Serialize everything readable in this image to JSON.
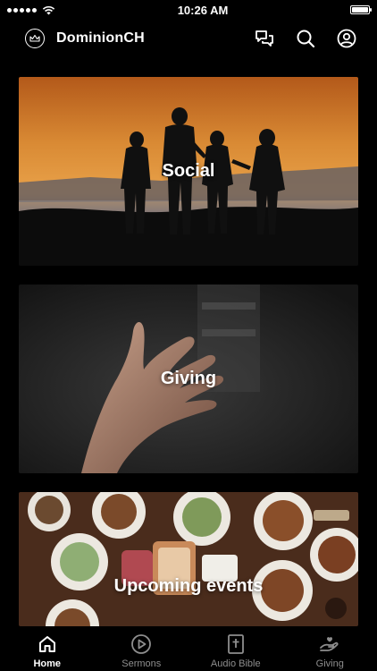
{
  "status_bar": {
    "time": "10:26 AM",
    "battery_level": 1.0
  },
  "header": {
    "title": "DominionCH",
    "icons": [
      "crown-logo-icon",
      "chat-icon",
      "search-icon",
      "profile-icon"
    ]
  },
  "cards": [
    {
      "label": "Social"
    },
    {
      "label": "Giving"
    },
    {
      "label": "Upcoming events"
    }
  ],
  "tab_bar": {
    "items": [
      {
        "label": "Home",
        "icon": "home-icon",
        "active": true
      },
      {
        "label": "Sermons",
        "icon": "play-circle-icon",
        "active": false
      },
      {
        "label": "Audio Bible",
        "icon": "bible-icon",
        "active": false
      },
      {
        "label": "Giving",
        "icon": "giving-hand-icon",
        "active": false
      }
    ]
  },
  "colors": {
    "background": "#000000",
    "active_tab": "#ffffff",
    "inactive_tab": "#8e8e8e"
  }
}
